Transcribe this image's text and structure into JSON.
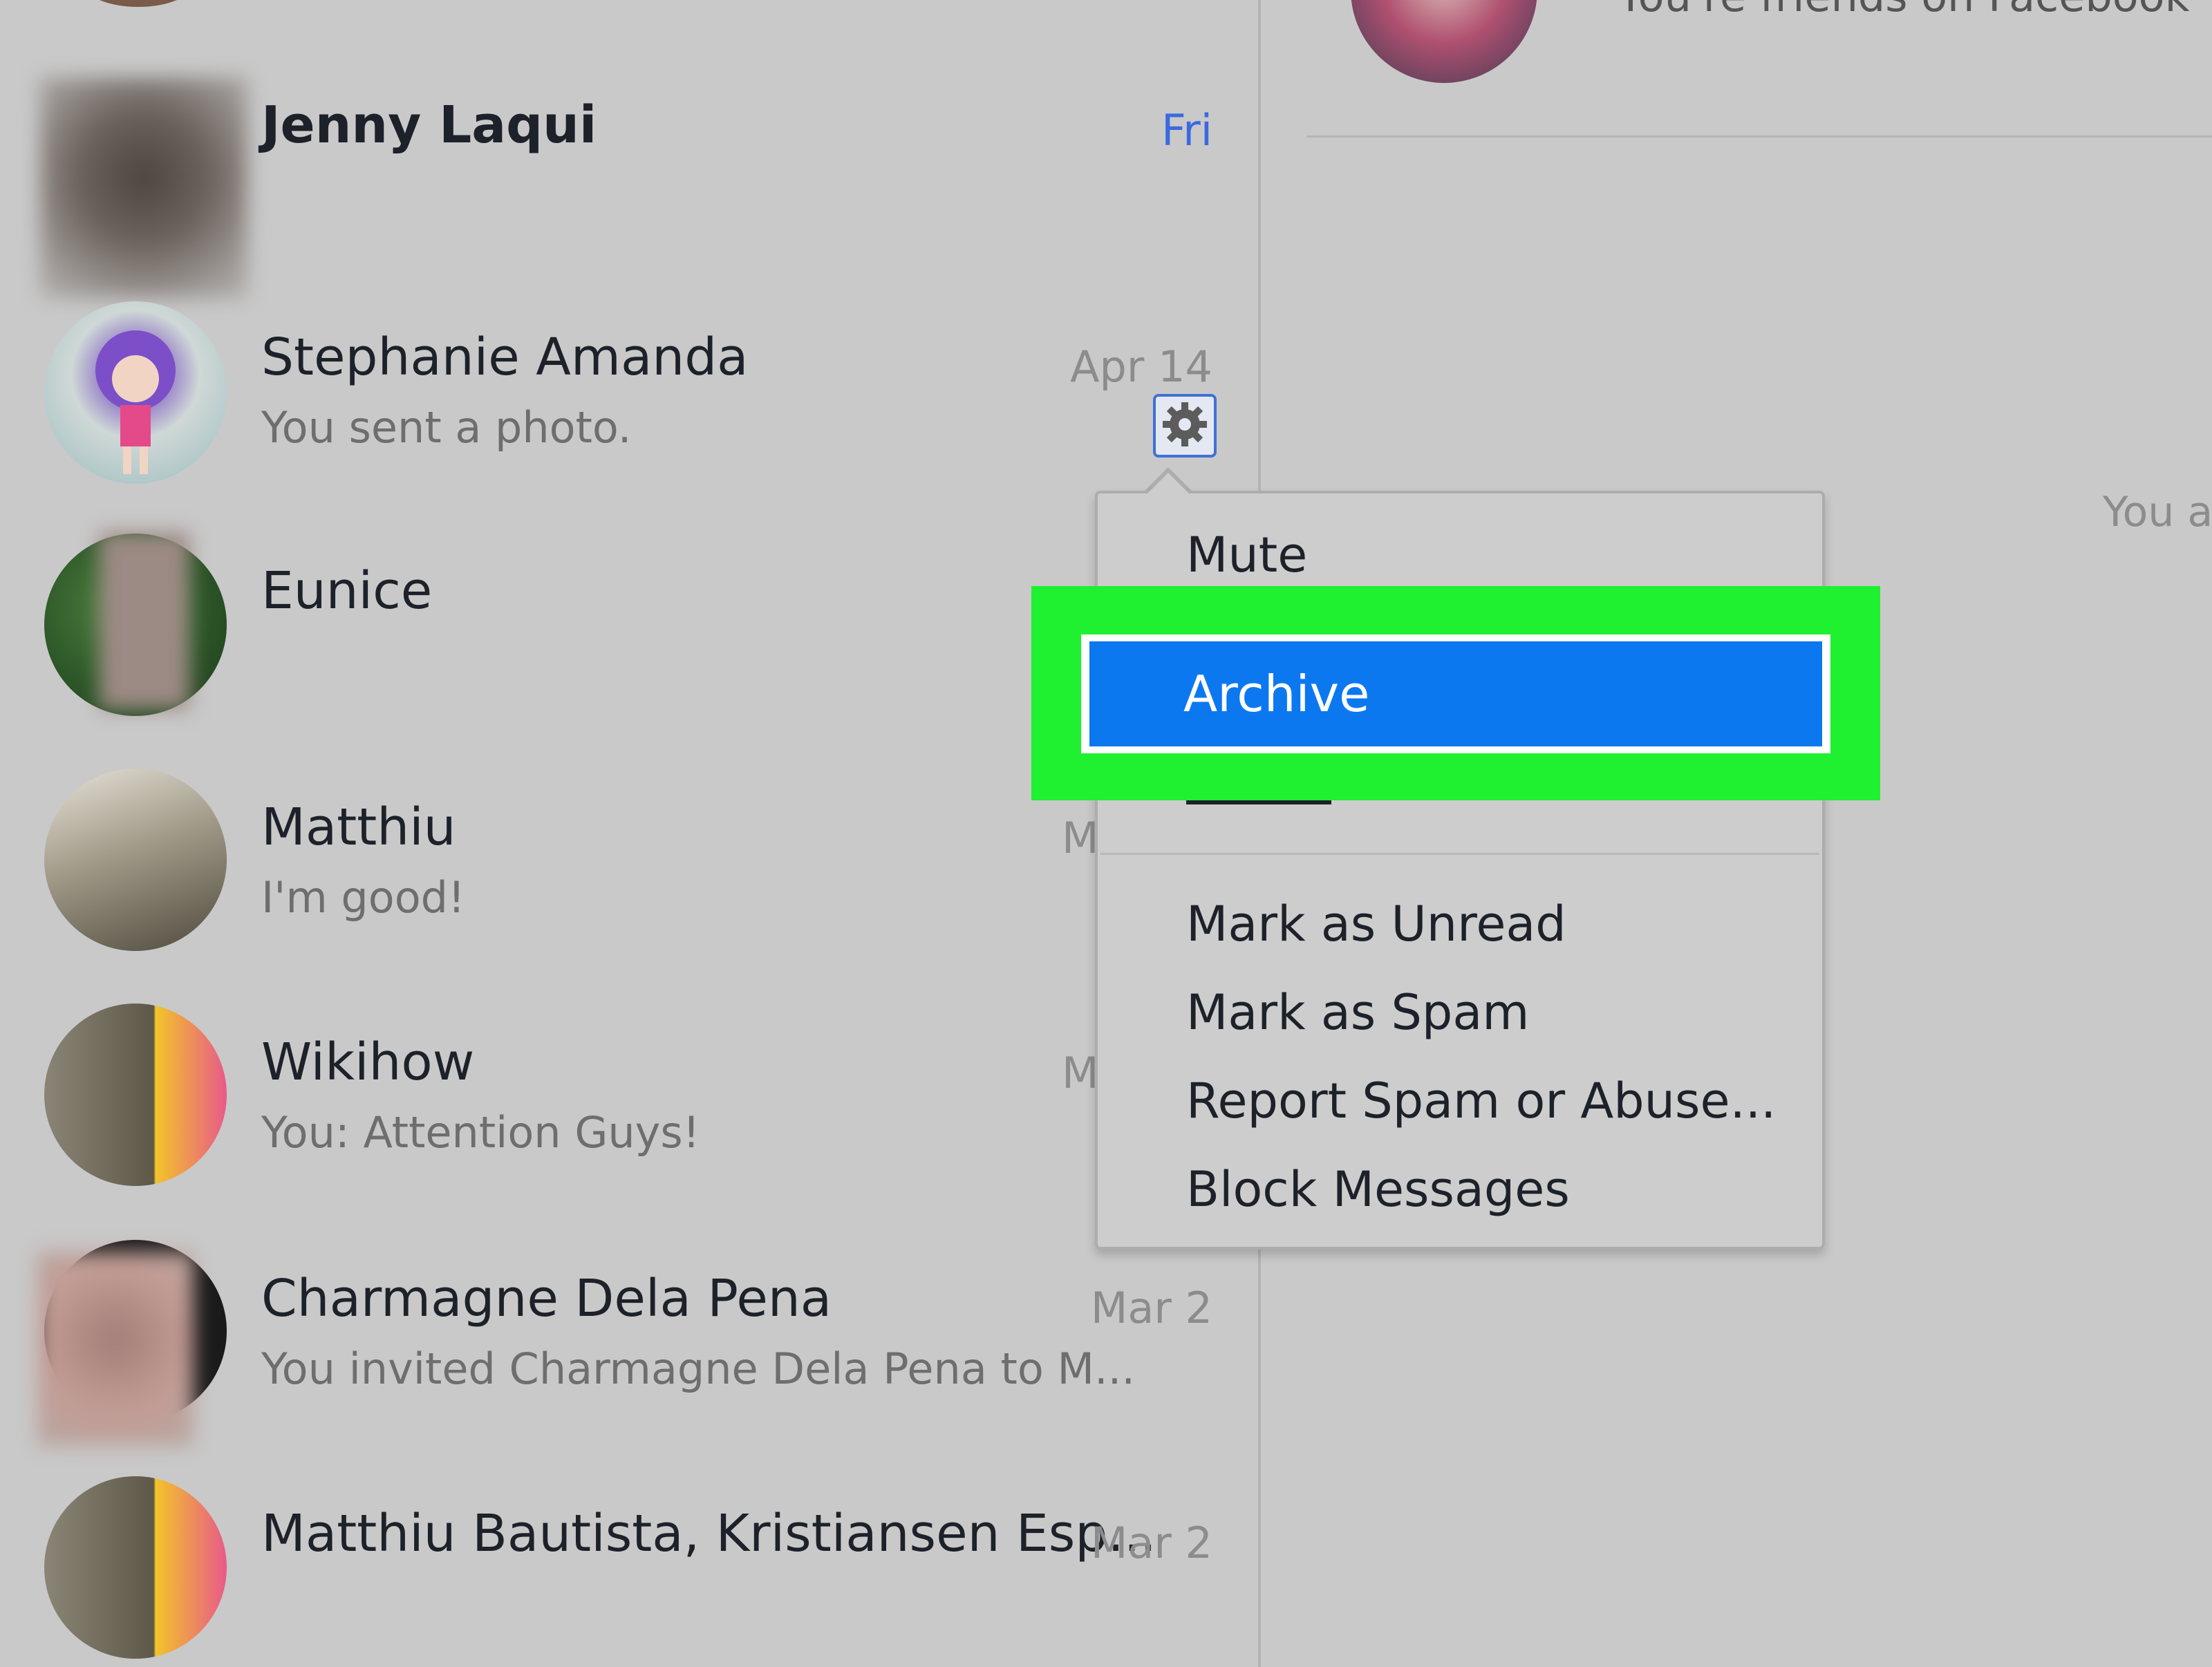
{
  "conversations": [
    {
      "name": "Jenny Laqui",
      "time": "Fri",
      "snippet": ""
    },
    {
      "name": "Stephanie Amanda",
      "time": "Apr 14",
      "snippet": "You sent a photo."
    },
    {
      "name": "Eunice",
      "time": "",
      "snippet": ""
    },
    {
      "name": "Matthiu",
      "time": "M",
      "snippet": "I'm good!"
    },
    {
      "name": "Wikihow",
      "time": "M",
      "snippet": "You: Attention Guys!"
    },
    {
      "name": "Charmagne Dela Pena",
      "time": "Mar 2",
      "snippet": "You invited Charmagne Dela Pena to M..."
    },
    {
      "name": "Matthiu Bautista, Kristiansen Esp...",
      "time": "Mar 2",
      "snippet": ""
    }
  ],
  "context_menu": {
    "mute": "Mute",
    "archive": "Archive",
    "mark_unread": "Mark as Unread",
    "mark_spam": "Mark as Spam",
    "report": "Report Spam or Abuse...",
    "block": "Block Messages"
  },
  "right_pane": {
    "header_text": "You're friends on Facebook",
    "side_text": "You a"
  },
  "colors": {
    "background": "#c9c9c9",
    "highlight_green": "#1ff02f",
    "selected_blue": "#0c78f0",
    "unread_time": "#3b69e0"
  },
  "icons": [
    "gear-icon"
  ]
}
